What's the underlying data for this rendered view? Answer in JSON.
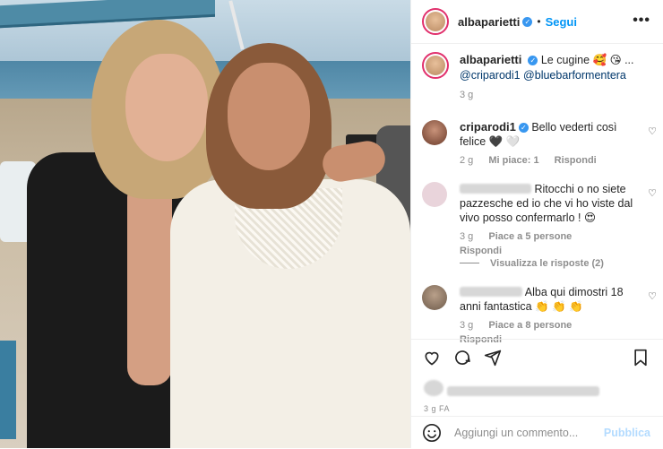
{
  "header": {
    "username": "albaparietti",
    "separator": "•",
    "follow_label": "Segui",
    "more_label": "•••"
  },
  "caption": {
    "username": "albaparietti",
    "text": "Le cugine 🥰 😘 ...",
    "mentions": "@criparodi1 @bluebarformentera",
    "time": "3 g"
  },
  "comments": [
    {
      "username": "criparodi1",
      "text": "Bello vederti così felice",
      "suffix": "🖤 🤍",
      "time": "2 g",
      "likes": "Mi piace: 1",
      "reply": "Rispondi"
    },
    {
      "username": "",
      "text": "Ritocchi o no siete pazzesche ed io che vi ho viste dal vivo posso confermarlo ! 😍",
      "time": "3 g",
      "likes": "Piace a 5 persone",
      "reply": "Rispondi"
    },
    {
      "username": "",
      "text": "Alba qui dimostri 18 anni fantastica 👏 👏 👏",
      "time": "3 g",
      "likes": "Piace a 8 persone",
      "reply": "Rispondi"
    }
  ],
  "view_replies": "Visualizza le risposte (2)",
  "footer": {
    "time": "3 g FA",
    "comment_placeholder": "Aggiungi un commento...",
    "publish_label": "Pubblica"
  },
  "colors": {
    "link": "#0095f6",
    "verified": "#3897f0",
    "muted": "#8e8e8e",
    "publish_disabled": "#b3dbff"
  },
  "icons": [
    "heart-icon",
    "comment-icon",
    "share-icon",
    "save-icon",
    "emoji-icon",
    "verified-icon",
    "more-icon"
  ]
}
